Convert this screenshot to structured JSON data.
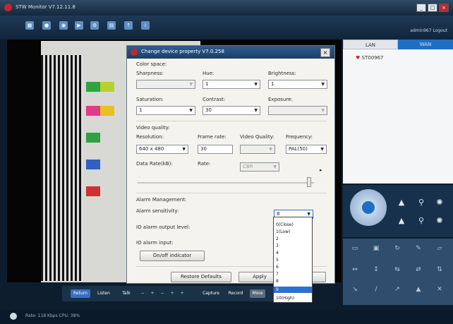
{
  "app": {
    "title": "STW Monitor    V7.12.11.8",
    "window_buttons": [
      "_",
      "□",
      "×"
    ],
    "user": "admin967  Logout"
  },
  "toolbar": {
    "icons": [
      "layout-icon",
      "camera-icon",
      "record-icon",
      "playback-icon",
      "settings-icon",
      "grid-icon",
      "upload-icon",
      "info-icon"
    ]
  },
  "device_tree": {
    "tabs": [
      "LAN",
      "WAN"
    ],
    "item": "ST00967"
  },
  "bottom_controls": {
    "buttons": [
      "Return",
      "Listen",
      "Talk",
      "Capture",
      "Record",
      "More"
    ]
  },
  "status": {
    "text": "Rate: 118 Kbps  CPU: 38%"
  },
  "dialog": {
    "title": "Change device property V7.0.258",
    "close": "×",
    "color_space": {
      "label": "Color space:",
      "sharpness_label": "Sharpness:",
      "sharpness": "",
      "hue_label": "Hue:",
      "hue": "1",
      "brightness_label": "Brightness:",
      "brightness": "1",
      "saturation_label": "Saturation:",
      "saturation": "1",
      "contrast_label": "Contrast:",
      "contrast": "30",
      "exposure_label": "Exposure:",
      "exposure": ""
    },
    "video_quality": {
      "label": "Video quality:",
      "resolution_label": "Resolution:",
      "resolution": "640 x 480",
      "frame_rate_label": "Frame rate:",
      "frame_rate": "30",
      "video_quality_label": "Video Quality:",
      "video_quality": "",
      "frequency_label": "Frequency:",
      "frequency": "PAL(50)",
      "data_rate_label": "Data Rate(kB):",
      "rate_label": "Rate:",
      "rate": "CBR"
    },
    "alarm": {
      "label": "Alarm Management:",
      "sensitivity_label": "Alarm sensitivity:",
      "sensitivity": "8",
      "io_output_label": "IO alarm output level:",
      "io_input_label": "IO alarm input:",
      "onoff_button": "On/off indicator"
    },
    "sensitivity_options": [
      "0(Close)",
      "1(Low)",
      "2",
      "3",
      "4",
      "5",
      "6",
      "7",
      "8",
      "9",
      "10(High)"
    ],
    "highlighted_option": 9,
    "buttons": {
      "restore": "Restore Defaults",
      "apply": "Apply",
      "cancel": ""
    }
  }
}
